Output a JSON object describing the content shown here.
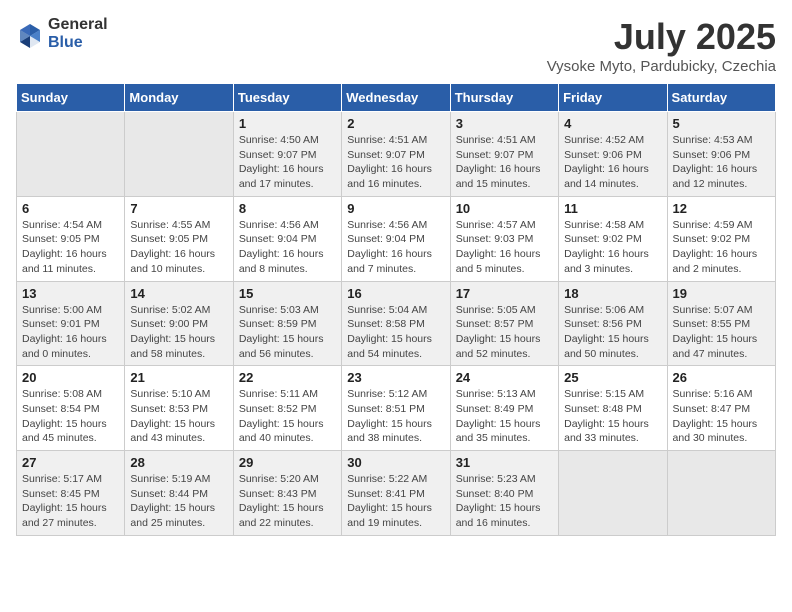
{
  "logo": {
    "general": "General",
    "blue": "Blue"
  },
  "title": "July 2025",
  "subtitle": "Vysoke Myto, Pardubicky, Czechia",
  "days_of_week": [
    "Sunday",
    "Monday",
    "Tuesday",
    "Wednesday",
    "Thursday",
    "Friday",
    "Saturday"
  ],
  "weeks": [
    [
      {
        "day": "",
        "empty": true
      },
      {
        "day": "",
        "empty": true
      },
      {
        "day": "1",
        "sunrise": "Sunrise: 4:50 AM",
        "sunset": "Sunset: 9:07 PM",
        "daylight": "Daylight: 16 hours and 17 minutes."
      },
      {
        "day": "2",
        "sunrise": "Sunrise: 4:51 AM",
        "sunset": "Sunset: 9:07 PM",
        "daylight": "Daylight: 16 hours and 16 minutes."
      },
      {
        "day": "3",
        "sunrise": "Sunrise: 4:51 AM",
        "sunset": "Sunset: 9:07 PM",
        "daylight": "Daylight: 16 hours and 15 minutes."
      },
      {
        "day": "4",
        "sunrise": "Sunrise: 4:52 AM",
        "sunset": "Sunset: 9:06 PM",
        "daylight": "Daylight: 16 hours and 14 minutes."
      },
      {
        "day": "5",
        "sunrise": "Sunrise: 4:53 AM",
        "sunset": "Sunset: 9:06 PM",
        "daylight": "Daylight: 16 hours and 12 minutes."
      }
    ],
    [
      {
        "day": "6",
        "sunrise": "Sunrise: 4:54 AM",
        "sunset": "Sunset: 9:05 PM",
        "daylight": "Daylight: 16 hours and 11 minutes."
      },
      {
        "day": "7",
        "sunrise": "Sunrise: 4:55 AM",
        "sunset": "Sunset: 9:05 PM",
        "daylight": "Daylight: 16 hours and 10 minutes."
      },
      {
        "day": "8",
        "sunrise": "Sunrise: 4:56 AM",
        "sunset": "Sunset: 9:04 PM",
        "daylight": "Daylight: 16 hours and 8 minutes."
      },
      {
        "day": "9",
        "sunrise": "Sunrise: 4:56 AM",
        "sunset": "Sunset: 9:04 PM",
        "daylight": "Daylight: 16 hours and 7 minutes."
      },
      {
        "day": "10",
        "sunrise": "Sunrise: 4:57 AM",
        "sunset": "Sunset: 9:03 PM",
        "daylight": "Daylight: 16 hours and 5 minutes."
      },
      {
        "day": "11",
        "sunrise": "Sunrise: 4:58 AM",
        "sunset": "Sunset: 9:02 PM",
        "daylight": "Daylight: 16 hours and 3 minutes."
      },
      {
        "day": "12",
        "sunrise": "Sunrise: 4:59 AM",
        "sunset": "Sunset: 9:02 PM",
        "daylight": "Daylight: 16 hours and 2 minutes."
      }
    ],
    [
      {
        "day": "13",
        "sunrise": "Sunrise: 5:00 AM",
        "sunset": "Sunset: 9:01 PM",
        "daylight": "Daylight: 16 hours and 0 minutes."
      },
      {
        "day": "14",
        "sunrise": "Sunrise: 5:02 AM",
        "sunset": "Sunset: 9:00 PM",
        "daylight": "Daylight: 15 hours and 58 minutes."
      },
      {
        "day": "15",
        "sunrise": "Sunrise: 5:03 AM",
        "sunset": "Sunset: 8:59 PM",
        "daylight": "Daylight: 15 hours and 56 minutes."
      },
      {
        "day": "16",
        "sunrise": "Sunrise: 5:04 AM",
        "sunset": "Sunset: 8:58 PM",
        "daylight": "Daylight: 15 hours and 54 minutes."
      },
      {
        "day": "17",
        "sunrise": "Sunrise: 5:05 AM",
        "sunset": "Sunset: 8:57 PM",
        "daylight": "Daylight: 15 hours and 52 minutes."
      },
      {
        "day": "18",
        "sunrise": "Sunrise: 5:06 AM",
        "sunset": "Sunset: 8:56 PM",
        "daylight": "Daylight: 15 hours and 50 minutes."
      },
      {
        "day": "19",
        "sunrise": "Sunrise: 5:07 AM",
        "sunset": "Sunset: 8:55 PM",
        "daylight": "Daylight: 15 hours and 47 minutes."
      }
    ],
    [
      {
        "day": "20",
        "sunrise": "Sunrise: 5:08 AM",
        "sunset": "Sunset: 8:54 PM",
        "daylight": "Daylight: 15 hours and 45 minutes."
      },
      {
        "day": "21",
        "sunrise": "Sunrise: 5:10 AM",
        "sunset": "Sunset: 8:53 PM",
        "daylight": "Daylight: 15 hours and 43 minutes."
      },
      {
        "day": "22",
        "sunrise": "Sunrise: 5:11 AM",
        "sunset": "Sunset: 8:52 PM",
        "daylight": "Daylight: 15 hours and 40 minutes."
      },
      {
        "day": "23",
        "sunrise": "Sunrise: 5:12 AM",
        "sunset": "Sunset: 8:51 PM",
        "daylight": "Daylight: 15 hours and 38 minutes."
      },
      {
        "day": "24",
        "sunrise": "Sunrise: 5:13 AM",
        "sunset": "Sunset: 8:49 PM",
        "daylight": "Daylight: 15 hours and 35 minutes."
      },
      {
        "day": "25",
        "sunrise": "Sunrise: 5:15 AM",
        "sunset": "Sunset: 8:48 PM",
        "daylight": "Daylight: 15 hours and 33 minutes."
      },
      {
        "day": "26",
        "sunrise": "Sunrise: 5:16 AM",
        "sunset": "Sunset: 8:47 PM",
        "daylight": "Daylight: 15 hours and 30 minutes."
      }
    ],
    [
      {
        "day": "27",
        "sunrise": "Sunrise: 5:17 AM",
        "sunset": "Sunset: 8:45 PM",
        "daylight": "Daylight: 15 hours and 27 minutes."
      },
      {
        "day": "28",
        "sunrise": "Sunrise: 5:19 AM",
        "sunset": "Sunset: 8:44 PM",
        "daylight": "Daylight: 15 hours and 25 minutes."
      },
      {
        "day": "29",
        "sunrise": "Sunrise: 5:20 AM",
        "sunset": "Sunset: 8:43 PM",
        "daylight": "Daylight: 15 hours and 22 minutes."
      },
      {
        "day": "30",
        "sunrise": "Sunrise: 5:22 AM",
        "sunset": "Sunset: 8:41 PM",
        "daylight": "Daylight: 15 hours and 19 minutes."
      },
      {
        "day": "31",
        "sunrise": "Sunrise: 5:23 AM",
        "sunset": "Sunset: 8:40 PM",
        "daylight": "Daylight: 15 hours and 16 minutes."
      },
      {
        "day": "",
        "empty": true
      },
      {
        "day": "",
        "empty": true
      }
    ]
  ]
}
